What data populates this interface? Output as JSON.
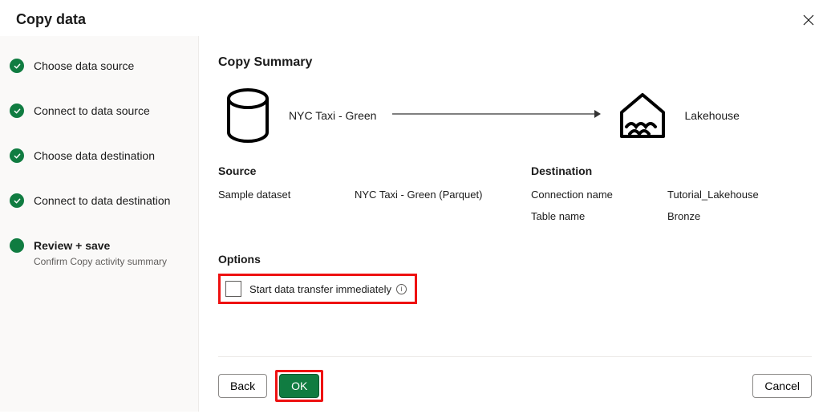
{
  "dialog": {
    "title": "Copy data"
  },
  "wizard": {
    "steps": [
      {
        "label": "Choose data source",
        "done": true,
        "current": false
      },
      {
        "label": "Connect to data source",
        "done": true,
        "current": false
      },
      {
        "label": "Choose data destination",
        "done": true,
        "current": false
      },
      {
        "label": "Connect to data destination",
        "done": true,
        "current": false
      },
      {
        "label": "Review + save",
        "done": false,
        "current": true,
        "sub": "Confirm Copy activity summary"
      }
    ]
  },
  "summary": {
    "title": "Copy Summary",
    "diagram": {
      "source_label": "NYC Taxi - Green",
      "dest_label": "Lakehouse"
    },
    "source": {
      "heading": "Source",
      "rows": [
        {
          "k": "Sample dataset",
          "v": "NYC Taxi - Green (Parquet)"
        }
      ]
    },
    "destination": {
      "heading": "Destination",
      "rows": [
        {
          "k": "Connection name",
          "v": "Tutorial_Lakehouse"
        },
        {
          "k": "Table name",
          "v": "Bronze"
        }
      ]
    },
    "options": {
      "heading": "Options",
      "start_label": "Start data transfer immediately",
      "start_checked": false
    }
  },
  "footer": {
    "back": "Back",
    "ok": "OK",
    "cancel": "Cancel"
  }
}
